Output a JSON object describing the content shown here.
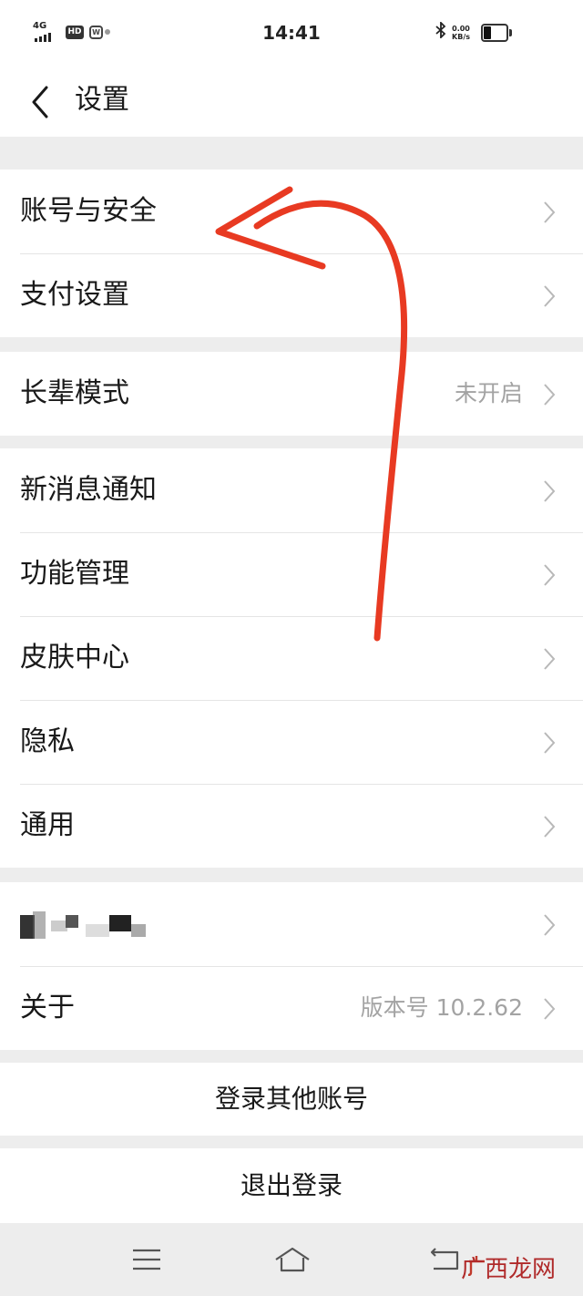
{
  "status_bar": {
    "network": "4G",
    "hd_badge": "HD",
    "time": "14:41",
    "speed_value": "0.00",
    "speed_unit": "KB/s",
    "battery_level": 0.35
  },
  "header": {
    "title": "设置"
  },
  "groups": [
    {
      "items": [
        {
          "label": "账号与安全"
        },
        {
          "label": "支付设置"
        }
      ]
    },
    {
      "items": [
        {
          "label": "长辈模式",
          "value": "未开启"
        }
      ]
    },
    {
      "items": [
        {
          "label": "新消息通知"
        },
        {
          "label": "功能管理"
        },
        {
          "label": "皮肤中心"
        },
        {
          "label": "隐私"
        },
        {
          "label": "通用"
        }
      ]
    },
    {
      "items": [
        {
          "label": "",
          "redacted": true
        },
        {
          "label": "关于",
          "value": "版本号 10.2.62"
        }
      ]
    }
  ],
  "actions": {
    "switch_account": "登录其他账号",
    "logout": "退出登录"
  },
  "watermark": "广西龙网",
  "colors": {
    "background": "#ededed",
    "surface": "#ffffff",
    "text": "#191919",
    "secondary_text": "#a3a3a3",
    "annotation_arrow": "#e83a22"
  },
  "icons": [
    "back-icon",
    "chevron-right-icon",
    "menu-icon",
    "home-icon",
    "return-icon",
    "bluetooth-icon",
    "battery-icon"
  ]
}
